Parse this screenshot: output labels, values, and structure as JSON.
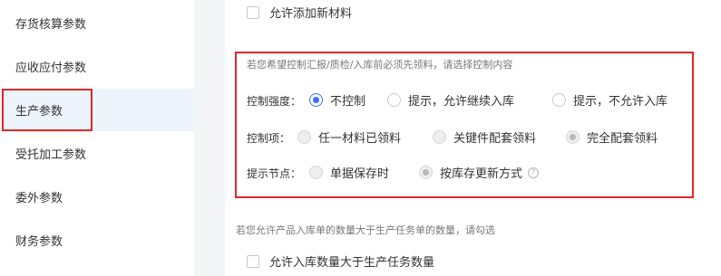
{
  "sidebar": {
    "items": [
      {
        "label": "存货核算参数"
      },
      {
        "label": "应收应付参数"
      },
      {
        "label": "生产参数"
      },
      {
        "label": "受托加工参数"
      },
      {
        "label": "委外参数"
      },
      {
        "label": "财务参数"
      }
    ],
    "active_index": 2
  },
  "main": {
    "allow_new_material": {
      "label": "允许添加新材料",
      "checked": false
    },
    "control_section": {
      "hint": "若您希望控制汇报/质检/入库前必须先领料，请选择控制内容",
      "strength": {
        "label": "控制强度：",
        "options": [
          "不控制",
          "提示，允许继续入库",
          "提示，不允许入库"
        ],
        "selected": "不控制"
      },
      "item": {
        "label": "控制项：",
        "options": [
          "任一材料已领料",
          "关键件配套领料",
          "完全配套领料"
        ],
        "selected": "完全配套领料",
        "disabled": true
      },
      "node": {
        "label": "提示节点：",
        "options": [
          "单据保存时",
          "按库存更新方式"
        ],
        "selected": "按库存更新方式",
        "disabled": true,
        "help_icon": "?"
      }
    },
    "excess_section": {
      "hint": "若您允许产品入库单的数量大于生产任务单的数量，请勾选",
      "checkbox": {
        "label": "允许入库数量大于生产任务数量",
        "checked": false
      }
    }
  },
  "colors": {
    "accent": "#3d6ff5",
    "highlight": "#e02727",
    "active_bg": "#eef4fc"
  }
}
